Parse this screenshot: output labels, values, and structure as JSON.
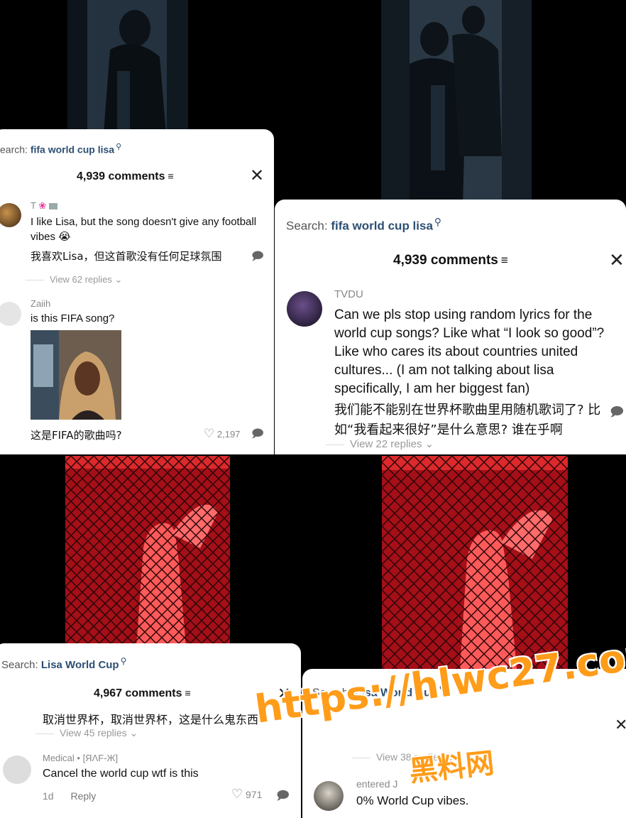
{
  "panel1": {
    "search_prefix": "earch:",
    "search_query": "fifa world cup lisa",
    "comment_count": "4,939 comments",
    "comment1": {
      "username": "T",
      "text": "I like Lisa, but the song doesn't give any football vibes 😭",
      "translation": "我喜欢Lisa，但这首歌没有任何足球氛围",
      "replies": "View 62 replies"
    },
    "comment2": {
      "username": "Zaiih",
      "text": "is this FIFA song?",
      "translation": "这是FIFA的歌曲吗?",
      "likes": "2,197"
    }
  },
  "panel2": {
    "search_prefix": "Search:",
    "search_query": "fifa world cup lisa",
    "comment_count": "4,939 comments",
    "comment1": {
      "username": "TVDU",
      "text": "Can we pls stop using random lyrics for the world cup songs? Like what  “I look so good”? Like who cares its about countries united cultures... (I am not talking about lisa specifically, I am her biggest fan)",
      "translation": "我们能不能别在世界杯歌曲里用随机歌词了? 比如“我看起来很好”是什么意思? 谁在乎啊",
      "replies": "View 22 replies"
    }
  },
  "panel3": {
    "search_prefix": "Search:",
    "search_query": "Lisa World Cup",
    "comment_count": "4,967 comments",
    "top_translation": "取消世界杯，取消世界杯，这是什么鬼东西",
    "replies": "View 45 replies",
    "comment1": {
      "username": "Medical • [ЯΛF-Ж]",
      "text": "Cancel the world cup wtf is this",
      "time": "1d",
      "reply_label": "Reply",
      "likes": "971"
    }
  },
  "panel4": {
    "search_prefix": "Search:",
    "search_query": "Lisa World Cup",
    "replies": "View 38 replies",
    "comment1": {
      "username": "entered J",
      "text": "0% World Cup vibes."
    }
  },
  "watermark": {
    "url": "https://hlwc27.com",
    "site": "黑料网"
  },
  "colors": {
    "search_query": "#2c4f73",
    "watermark": "#ff9c19",
    "cage_red": "#c8141e"
  }
}
